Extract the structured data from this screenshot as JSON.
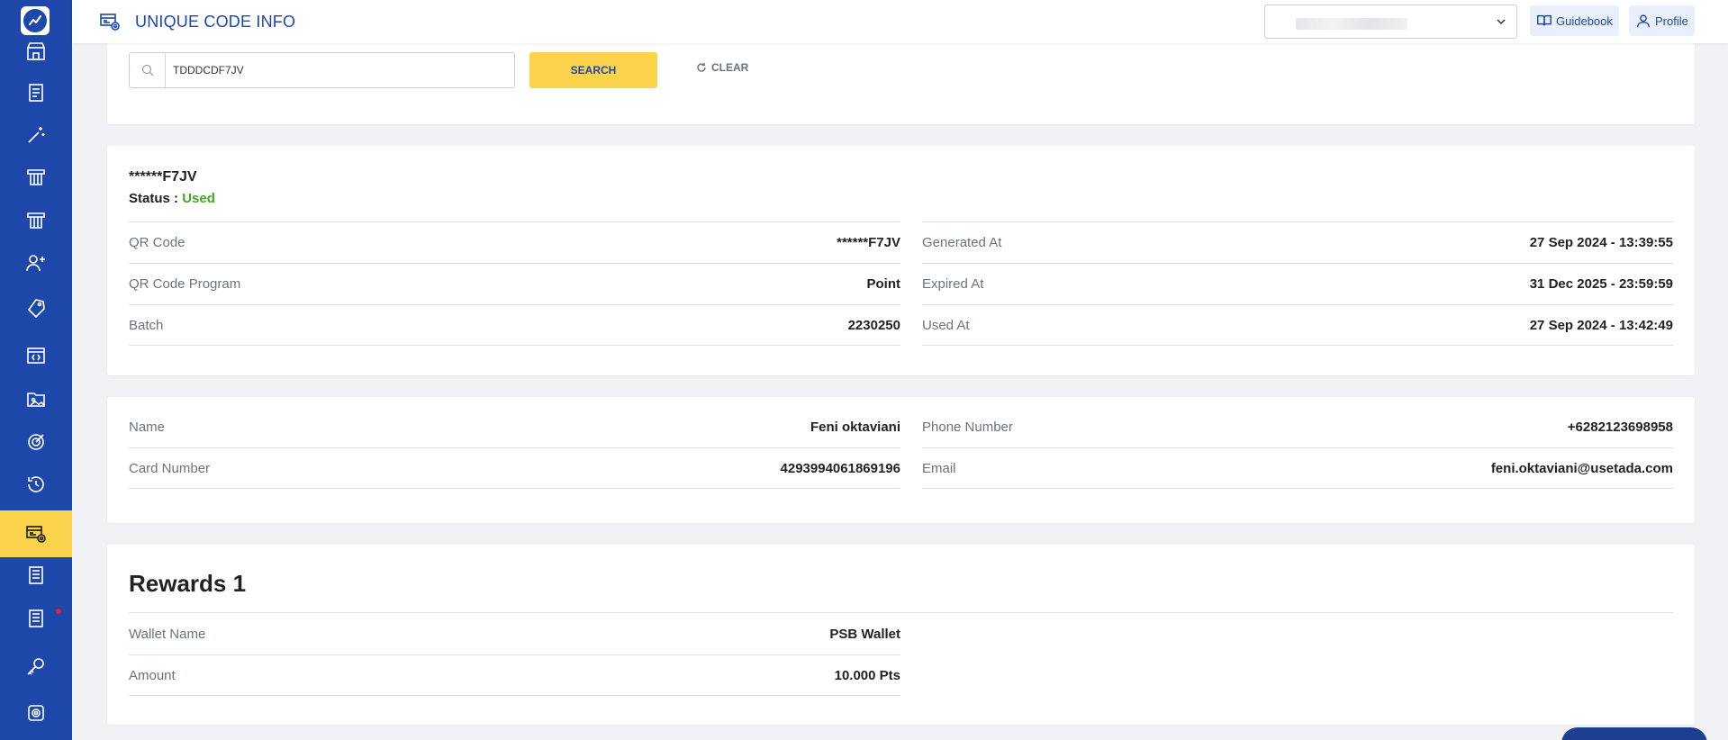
{
  "header": {
    "title": "UNIQUE CODE INFO",
    "guidebook_label": "Guidebook",
    "profile_label": "Profile"
  },
  "search": {
    "value": "TDDDCDF7JV",
    "search_label": "SEARCH",
    "clear_label": "CLEAR"
  },
  "code_info": {
    "masked_code": "******F7JV",
    "status_label": "Status : ",
    "status_value": "Used",
    "left": [
      {
        "label": "QR Code",
        "value": "******F7JV"
      },
      {
        "label": "QR Code Program",
        "value": "Point"
      },
      {
        "label": "Batch",
        "value": "2230250"
      }
    ],
    "right": [
      {
        "label": "Generated At",
        "value": "27 Sep 2024 - 13:39:55"
      },
      {
        "label": "Expired At",
        "value": "31 Dec 2025 - 23:59:59"
      },
      {
        "label": "Used At",
        "value": "27 Sep 2024 - 13:42:49"
      }
    ]
  },
  "user_info": {
    "left": [
      {
        "label": "Name",
        "value": "Feni oktaviani"
      },
      {
        "label": "Card Number",
        "value": "4293994061869196"
      }
    ],
    "right": [
      {
        "label": "Phone Number",
        "value": "+6282123698958"
      },
      {
        "label": "Email",
        "value": "feni.oktaviani@usetada.com"
      }
    ]
  },
  "rewards": {
    "title": "Rewards 1",
    "items": [
      {
        "label": "Wallet Name",
        "value": "PSB Wallet"
      },
      {
        "label": "Amount",
        "value": "10.000 Pts"
      }
    ]
  },
  "sidebar": {
    "icons": [
      "store-icon",
      "receipt-icon",
      "magic-wand-icon",
      "voucher-icon",
      "voucher-alt-icon",
      "add-user-icon",
      "tag-icon",
      "code-window-icon",
      "image-folder-icon",
      "target-icon",
      "history-icon",
      "qr-code-info-icon",
      "report-icon",
      "report-alt-icon",
      "key-icon",
      "settings-icon"
    ],
    "active": "qr-code-info-icon"
  },
  "colors": {
    "primary": "#1d47a8",
    "accent": "#fcd34d",
    "status_used": "#3eaa1c"
  }
}
